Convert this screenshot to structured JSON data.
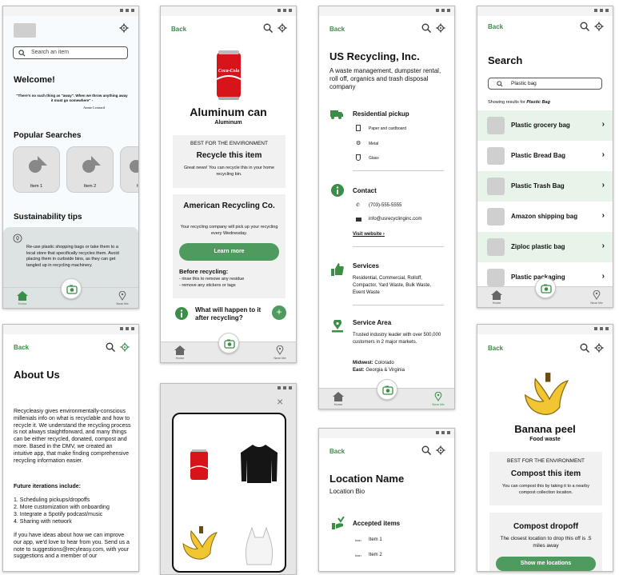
{
  "colors": {
    "accent": "#3a8e46",
    "nav": "#e9e9e9",
    "card": "#f1f1f1",
    "highlight": "#e8f4ea"
  },
  "common": {
    "back": "Back",
    "home": "Home",
    "near_me": "Near Me"
  },
  "home": {
    "search_placeholder": "Search an item",
    "welcome": "Welcome!",
    "quote": "\"There's no such thing as \"away\". When we throw anything away it must go somewhere\" -",
    "quote_author": "Annie Leonard",
    "popular_title": "Popular Searches",
    "popular_items": [
      "Item 1",
      "Item 2",
      "It"
    ],
    "tips_title": "Sustainability tips",
    "tip_text": "Re-use plastic shopping bags or take them to a local store that specifically recycles them. Avoid placing them in curbside bins, as they can get tangled up in recycling machinery."
  },
  "can": {
    "title": "Aluminum can",
    "subtitle": "Aluminum",
    "best_label": "BEST FOR THE ENVIRONMENT",
    "action": "Recycle this item",
    "action_desc": "Great news! You can recycle this in your home recycling bin.",
    "company": "American Recycling Co.",
    "company_desc": "Your recycling company will pick up your recycling every Wednesday.",
    "learn_more": "Learn more",
    "before_title": "Before recycling:",
    "before_items": [
      "- rinse this to remove any residue",
      "- remove any stickers or tags"
    ],
    "what_happens": "What will happen to it after recycling?",
    "logo_text": "Coca-Cola"
  },
  "company": {
    "title": "US Recycling, Inc.",
    "desc": "A waste management, dumpster rental, roll off, organics and trash disposal company",
    "pickup_title": "Residential pickup",
    "pickup_items": [
      "Paper and cardboard",
      "Metal",
      "Glass"
    ],
    "contact_title": "Contact",
    "phone": "(703)-555-5555",
    "email": "info@usrecyclinginc.com",
    "visit": "Visit website",
    "services_title": "Services",
    "services_text": "Residential, Commercial, Rolloff, Compactor, Yard Waste, Bulk Waste, Event Waste",
    "area_title": "Service Area",
    "area_text": "Trusted industry leader with over 500,000 customers in 2 major markets.",
    "midwest_label": "Midwest:",
    "midwest_value": "Colorado",
    "east_label": "East:",
    "east_value": "Georgia & Virginia"
  },
  "search": {
    "title": "Search",
    "query": "Plastic bag",
    "showing_prefix": "Showing results for ",
    "showing_query": "Plastic Bag",
    "results": [
      "Plastic grocery bag",
      "Plastic Bread Bag",
      "Plastic Trash Bag",
      "Amazon shipping bag",
      "Ziploc plastic bag",
      "Plastic packaging"
    ]
  },
  "about": {
    "title": "About Us",
    "body": "Recycleasiy gives environmentally-conscious millenials info on what is recyclable and how to recycle it. We understand the recycling process is not always staightforward, and many things can be either recycled, donated, compost and more. Based in the DMV, we created an intuitive app, that make finding comprehensive recycling information easier.",
    "future_title": "Future iterations include:",
    "future_items": [
      "1. Scheduling pickups/dropoffs",
      "2. More customization with onboarding",
      "3. Integrate a Spotify podcast/music",
      "4. Sharing with network"
    ],
    "ideas": "If you have ideas about how we can improve our app, we'd love to hear from you. Send us a note to suggestions@recyleasy.com, with your suggestions and a member of our"
  },
  "camera": {
    "close": "×"
  },
  "location": {
    "title": "Location Name",
    "bio": "Location Bio",
    "accepted_title": "Accepted items",
    "icon_label": "Icon",
    "items": [
      "Item 1",
      "Item 2"
    ]
  },
  "banana": {
    "title": "Banana peel",
    "subtitle": "Food waste",
    "best_label": "BEST FOR THE ENVIRONMENT",
    "action": "Compost this item",
    "action_desc": "You can compost this by taking it to a nearby compost collection location.",
    "dropoff_title": "Compost dropoff",
    "dropoff_desc": "The closest location to drop this off is .5 miles away",
    "show_me": "Show me locations"
  }
}
